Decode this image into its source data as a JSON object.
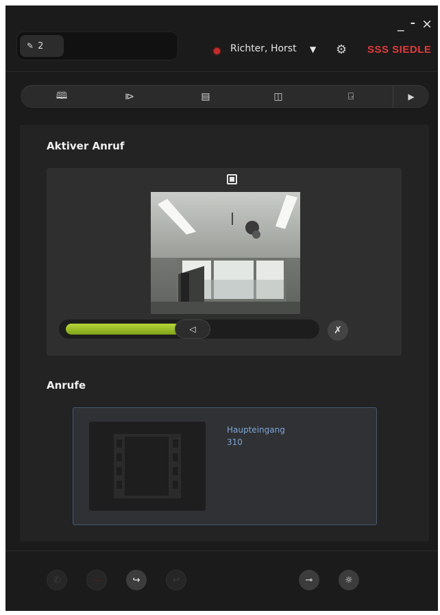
{
  "window": {
    "controls_label": "_ ⁃ ×"
  },
  "header": {
    "extension": "2",
    "user": "Richter, Horst",
    "logo": "SSS SIEDLE",
    "status_color": "#c62a2a"
  },
  "toolbar": {
    "items": [
      {
        "icon": "map-book-icon",
        "glyph": "🕮"
      },
      {
        "icon": "speaker-signal-icon",
        "glyph": "⧐"
      },
      {
        "icon": "single-panel-icon",
        "glyph": "▤"
      },
      {
        "icon": "split-panel-icon",
        "glyph": "◫"
      },
      {
        "icon": "door-open-icon",
        "glyph": "⍈"
      },
      {
        "icon": "play-icon",
        "glyph": "▶"
      }
    ]
  },
  "active_call": {
    "heading": "Aktiver Anruf",
    "volume_level": 0.45,
    "speaker_icon": "speaker-icon",
    "mic_icon": "mic-mute-icon"
  },
  "calls": {
    "heading": "Anrufe",
    "items": [
      {
        "name": "Haupteingang",
        "number": "310",
        "thumb_icon": "film-strip-icon"
      }
    ]
  },
  "footer": {
    "buttons": [
      {
        "icon": "call-accept-icon",
        "glyph": "✆",
        "enabled": false
      },
      {
        "icon": "hangup-icon",
        "glyph": "—",
        "enabled": false
      },
      {
        "icon": "forward-icon",
        "glyph": "↪",
        "enabled": true
      },
      {
        "icon": "back-icon",
        "glyph": "↩",
        "enabled": false
      },
      {
        "icon": "door-key-icon",
        "glyph": "⊸",
        "enabled": true
      },
      {
        "icon": "light-icon",
        "glyph": "☼",
        "enabled": true
      }
    ]
  },
  "colors": {
    "accent_green": "#9cc22b",
    "link_blue": "#7fa5d6",
    "brand_red": "#e23b3b"
  }
}
